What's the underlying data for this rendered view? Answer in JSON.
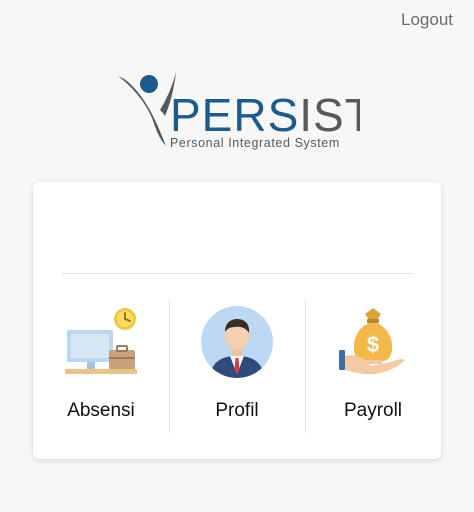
{
  "header": {
    "logout_label": "Logout"
  },
  "logo": {
    "brand_prefix": "PERS",
    "brand_accent": "I",
    "brand_suffix": "ST",
    "tagline": "Personal Integrated System"
  },
  "colors": {
    "brand_blue": "#1f5a8c",
    "brand_gray": "#555a5e",
    "background": "#f7f7f7"
  },
  "menu": {
    "items": [
      {
        "label": "Absensi",
        "icon": "attendance-desk-clock-icon"
      },
      {
        "label": "Profil",
        "icon": "profile-person-icon"
      },
      {
        "label": "Payroll",
        "icon": "payroll-money-bag-icon"
      }
    ]
  }
}
